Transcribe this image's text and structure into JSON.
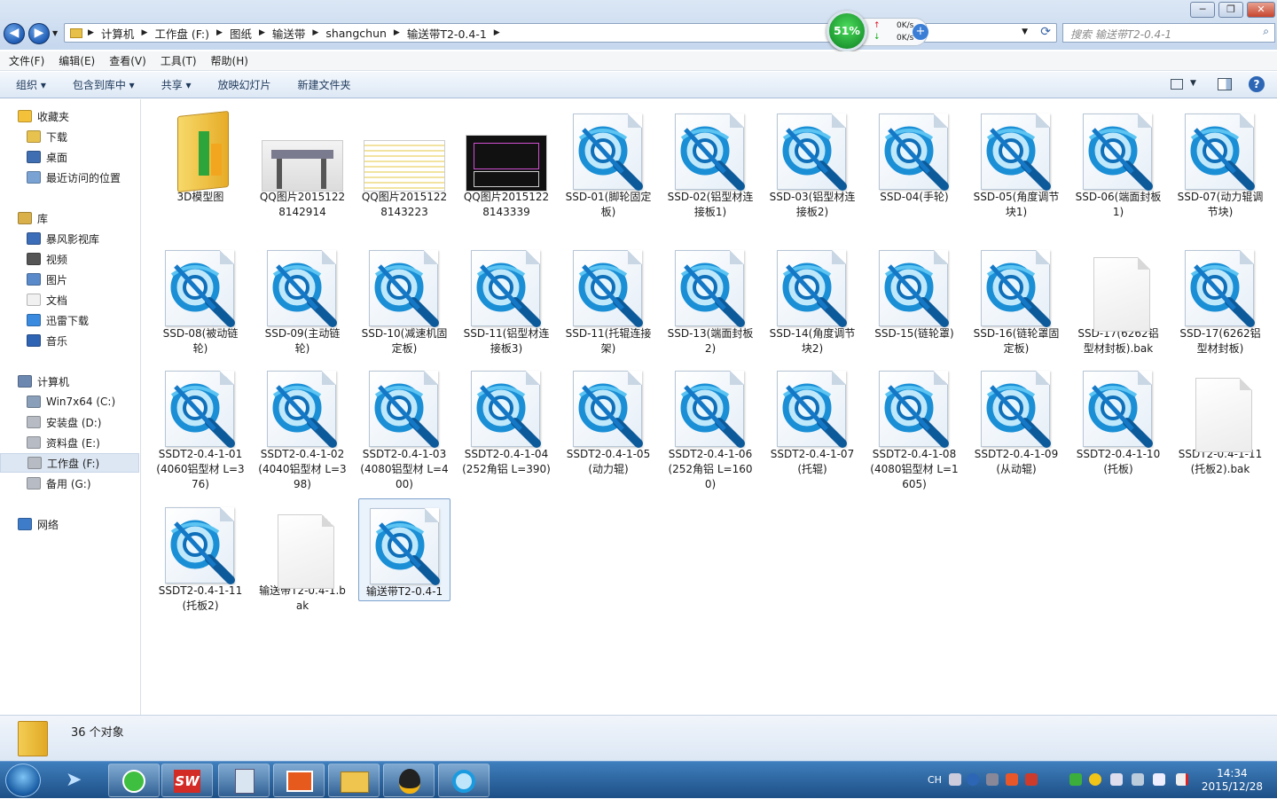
{
  "window": {
    "breadcrumb": [
      "计算机",
      "工作盘 (F:)",
      "图纸",
      "输送带",
      "shangchun",
      "输送带T2-0.4-1"
    ],
    "search_placeholder": "搜索 输送带T2-0.4-1",
    "controls": [
      "─",
      "❐",
      "✕"
    ]
  },
  "net_monitor": {
    "percent": "51%",
    "up": "0K/s",
    "down": "0K/s"
  },
  "menu": [
    "文件(F)",
    "编辑(E)",
    "查看(V)",
    "工具(T)",
    "帮助(H)"
  ],
  "toolbar": [
    "组织 ▾",
    "包含到库中 ▾",
    "共享 ▾",
    "放映幻灯片",
    "新建文件夹"
  ],
  "sidebar": [
    {
      "label": "收藏夹",
      "icon": "star-icon",
      "group": true
    },
    {
      "label": "下载",
      "icon": "download-folder-icon"
    },
    {
      "label": "桌面",
      "icon": "desktop-icon"
    },
    {
      "label": "最近访问的位置",
      "icon": "recent-places-icon"
    },
    {
      "label": "库",
      "icon": "library-icon",
      "group": true
    },
    {
      "label": "暴风影视库",
      "icon": "video-library-icon"
    },
    {
      "label": "视频",
      "icon": "video-icon"
    },
    {
      "label": "图片",
      "icon": "picture-icon"
    },
    {
      "label": "文档",
      "icon": "document-icon"
    },
    {
      "label": "迅雷下载",
      "icon": "thunder-icon"
    },
    {
      "label": "音乐",
      "icon": "music-icon"
    },
    {
      "label": "计算机",
      "icon": "computer-icon",
      "group": true
    },
    {
      "label": "Win7x64 (C:)",
      "icon": "system-drive-icon"
    },
    {
      "label": "安装盘 (D:)",
      "icon": "drive-icon"
    },
    {
      "label": "资料盘 (E:)",
      "icon": "drive-icon"
    },
    {
      "label": "工作盘 (F:)",
      "icon": "drive-icon",
      "selected": true
    },
    {
      "label": "备用 (G:)",
      "icon": "drive-icon"
    },
    {
      "label": "网络",
      "icon": "network-icon",
      "group": true
    }
  ],
  "files": [
    {
      "name": "3D模型图",
      "type": "folder"
    },
    {
      "name": "QQ图片20151228142914",
      "type": "photo-machine"
    },
    {
      "name": "QQ图片20151228143223",
      "type": "photo-list"
    },
    {
      "name": "QQ图片20151228143339",
      "type": "photo-cad"
    },
    {
      "name": "SSD-01(脚轮固定板)",
      "type": "solidworks"
    },
    {
      "name": "SSD-02(铝型材连接板1)",
      "type": "solidworks"
    },
    {
      "name": "SSD-03(铝型材连接板2)",
      "type": "solidworks"
    },
    {
      "name": "SSD-04(手轮)",
      "type": "solidworks"
    },
    {
      "name": "SSD-05(角度调节块1)",
      "type": "solidworks"
    },
    {
      "name": "SSD-06(端面封板1)",
      "type": "solidworks"
    },
    {
      "name": "SSD-07(动力辊调节块)",
      "type": "solidworks"
    },
    {
      "name": "SSD-08(被动链轮)",
      "type": "solidworks"
    },
    {
      "name": "SSD-09(主动链轮)",
      "type": "solidworks"
    },
    {
      "name": "SSD-10(减速机固定板)",
      "type": "solidworks"
    },
    {
      "name": "SSD-11(铝型材连接板3)",
      "type": "solidworks"
    },
    {
      "name": "SSD-11(托辊连接架)",
      "type": "solidworks"
    },
    {
      "name": "SSD-13(端面封板2)",
      "type": "solidworks"
    },
    {
      "name": "SSD-14(角度调节块2)",
      "type": "solidworks"
    },
    {
      "name": "SSD-15(链轮罩)",
      "type": "solidworks"
    },
    {
      "name": "SSD-16(链轮罩固定板)",
      "type": "solidworks"
    },
    {
      "name": "SSD-17(6262铝型材封板).bak",
      "type": "blank"
    },
    {
      "name": "SSD-17(6262铝型材封板)",
      "type": "solidworks"
    },
    {
      "name": "SSDT2-0.4-1-01 (4060铝型材 L=376)",
      "type": "solidworks"
    },
    {
      "name": "SSDT2-0.4-1-02 (4040铝型材 L=398)",
      "type": "solidworks"
    },
    {
      "name": "SSDT2-0.4-1-03 (4080铝型材 L=400)",
      "type": "solidworks"
    },
    {
      "name": "SSDT2-0.4-1-04 (252角铝 L=390)",
      "type": "solidworks"
    },
    {
      "name": "SSDT2-0.4-1-05 (动力辊)",
      "type": "solidworks"
    },
    {
      "name": "SSDT2-0.4-1-06 (252角铝 L=1600)",
      "type": "solidworks"
    },
    {
      "name": "SSDT2-0.4-1-07 (托辊)",
      "type": "solidworks"
    },
    {
      "name": "SSDT2-0.4-1-08 (4080铝型材 L=1605)",
      "type": "solidworks"
    },
    {
      "name": "SSDT2-0.4-1-09 (从动辊)",
      "type": "solidworks"
    },
    {
      "name": "SSDT2-0.4-1-10 (托板)",
      "type": "solidworks"
    },
    {
      "name": "SSDT2-0.4-1-11 (托板2).bak",
      "type": "blank"
    },
    {
      "name": "SSDT2-0.4-1-11 (托板2)",
      "type": "solidworks"
    },
    {
      "name": "输送带T2-0.4-1.bak",
      "type": "blank"
    },
    {
      "name": "输送带T2-0.4-1",
      "type": "solidworks",
      "selected": true
    }
  ],
  "status": {
    "count": "36 个对象"
  },
  "tray": {
    "lang": "CH",
    "time": "14:34",
    "date": "2015/12/28"
  },
  "colors": {
    "accent": "#1f5db5",
    "solidworks_blue": "#1a8fd6",
    "taskbar": "#2a5f99"
  }
}
